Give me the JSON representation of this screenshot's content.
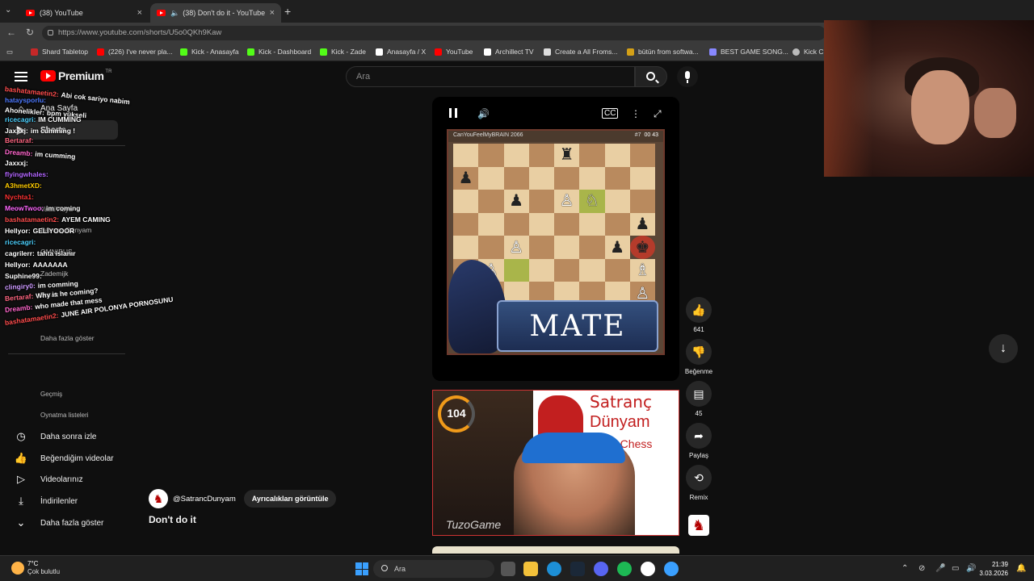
{
  "browser": {
    "tabs": [
      {
        "label": "(38) YouTube",
        "active": false
      },
      {
        "label": "(38) Don't do it - YouTube",
        "active": true
      }
    ],
    "url": "https://www.youtube.com/shorts/U5o0QKh9Kaw",
    "bookmarks": [
      {
        "label": "Shard Tabletop",
        "color": "#c62828"
      },
      {
        "label": "(226) I've never pla...",
        "color": "#ff0000"
      },
      {
        "label": "Kick - Anasayfa",
        "color": "#53fc18"
      },
      {
        "label": "Kick - Dashboard",
        "color": "#53fc18"
      },
      {
        "label": "Kick - Zade",
        "color": "#53fc18"
      },
      {
        "label": "Anasayfa / X",
        "color": "#ffffff"
      },
      {
        "label": "YouTube",
        "color": "#ff0000"
      },
      {
        "label": "Archillect TV",
        "color": "#ffffff"
      },
      {
        "label": "Create a All Froms...",
        "color": "#dddddd"
      },
      {
        "label": "bütün from softwa...",
        "color": "#d4a017"
      },
      {
        "label": "BEST GAME SONG...",
        "color": "#8888ff"
      },
      {
        "label": "Kick Ch",
        "color": "#bbbbbb"
      }
    ]
  },
  "youtube": {
    "brand": "Premium",
    "region": "TR",
    "search_placeholder": "Ara",
    "sidebar": {
      "items": [
        {
          "label": "Ana Sayfa",
          "icon": "home-icon"
        },
        {
          "label": "Shorts",
          "icon": "shorts-icon"
        }
      ],
      "subscriptions": [
        "VaatiVidya",
        "Satranç Dünyam",
        "OMNIBUS",
        "Zademijk",
        "Burak",
        "Daha fazla göster"
      ],
      "you_items": [
        {
          "label": "Geçmiş",
          "icon": "history-icon"
        },
        {
          "label": "Oynatma listeleri",
          "icon": "playlist-icon"
        },
        {
          "label": "Daha sonra izle",
          "icon": "clock-icon"
        },
        {
          "label": "Beğendiğim videolar",
          "icon": "thumbs-up-icon"
        },
        {
          "label": "Videolarınız",
          "icon": "video-icon"
        },
        {
          "label": "İndirilenler",
          "icon": "download-icon"
        },
        {
          "label": "Daha fazla göster",
          "icon": "chevron-down-icon"
        }
      ]
    },
    "short": {
      "chess_header_player": "CanYouFeelMyBRAIN",
      "chess_header_rating": "2066",
      "chess_header_rank": "#7",
      "chess_timer": "00 43",
      "banner_text": "MATE",
      "channel_handle": "@SatrancDunyam",
      "join_label": "Ayrıcalıkları görüntüle",
      "title": "Don't do it",
      "actions": [
        {
          "label": "641",
          "icon": "like-icon"
        },
        {
          "label": "Beğenme",
          "icon": "dislike-icon"
        },
        {
          "label": "45",
          "icon": "comment-icon"
        },
        {
          "label": "Paylaş",
          "icon": "share-icon"
        },
        {
          "label": "Remix",
          "icon": "remix-icon"
        }
      ]
    },
    "facecam": {
      "title_line1": "Satranç",
      "title_line2": "Dünyam",
      "title_line3": "n Chess",
      "counter": "104",
      "brand": "TuzoGame"
    }
  },
  "chat": [
    {
      "user": "bashatamaetin2:",
      "msg": "Abi cok sariyo nabim",
      "color": "#ff4d4d"
    },
    {
      "user": "hataysporlu:",
      "msg": "",
      "color": "#4d79ff"
    },
    {
      "user": "Ahonelikler:",
      "msg": "bpm yükseli",
      "color": "#ffffff"
    },
    {
      "user": "ricecagri:",
      "msg": "IM CUMMING",
      "color": "#4dd2ff"
    },
    {
      "user": "Jaxxxj:",
      "msg": "im cumming !",
      "color": "#ffffff"
    },
    {
      "user": "Bertaraf:",
      "msg": "",
      "color": "#ff6680"
    },
    {
      "user": "Dreamb:",
      "msg": "im cumming",
      "color": "#ff66cc"
    },
    {
      "user": "Jaxxxj:",
      "msg": "",
      "color": "#ffffff"
    },
    {
      "user": "flyingwhales:",
      "msg": "",
      "color": "#b366ff"
    },
    {
      "user": "A3hmetXD:",
      "msg": "",
      "color": "#ffcc00"
    },
    {
      "user": "Nychta1:",
      "msg": "",
      "color": "#ff3333"
    },
    {
      "user": "MeowTwoo:",
      "msg": "im coming",
      "color": "#ff66ff"
    },
    {
      "user": "bashatamaetin2:",
      "msg": "AYEM CAMING",
      "color": "#ff4d4d"
    },
    {
      "user": "Hellyor:",
      "msg": "GELİYOOOR",
      "color": "#ffffff"
    },
    {
      "user": "ricecagri:",
      "msg": "",
      "color": "#4dd2ff"
    },
    {
      "user": "cagrilerr:",
      "msg": "tahta islanır",
      "color": "#ffffff"
    },
    {
      "user": "Hellyor:",
      "msg": "AAAAAAA",
      "color": "#ffffff"
    },
    {
      "user": "Suphine99:",
      "msg": "",
      "color": "#ffffff"
    },
    {
      "user": "clingiry0:",
      "msg": "im comming",
      "color": "#cc99ff"
    },
    {
      "user": "Bertaraf:",
      "msg": "Why is he coming?",
      "color": "#ff6680"
    },
    {
      "user": "Dreamb:",
      "msg": "who made that mess",
      "color": "#ff66cc"
    },
    {
      "user": "bashatamaetin2:",
      "msg": "JUNE AIR POLONYA PORNOSUNU",
      "color": "#ff4d4d"
    }
  ],
  "taskbar": {
    "temperature": "7°C",
    "weather": "Çok bulutlu",
    "search_placeholder": "Ara",
    "time": "21:39",
    "date": "3.03.2026"
  }
}
